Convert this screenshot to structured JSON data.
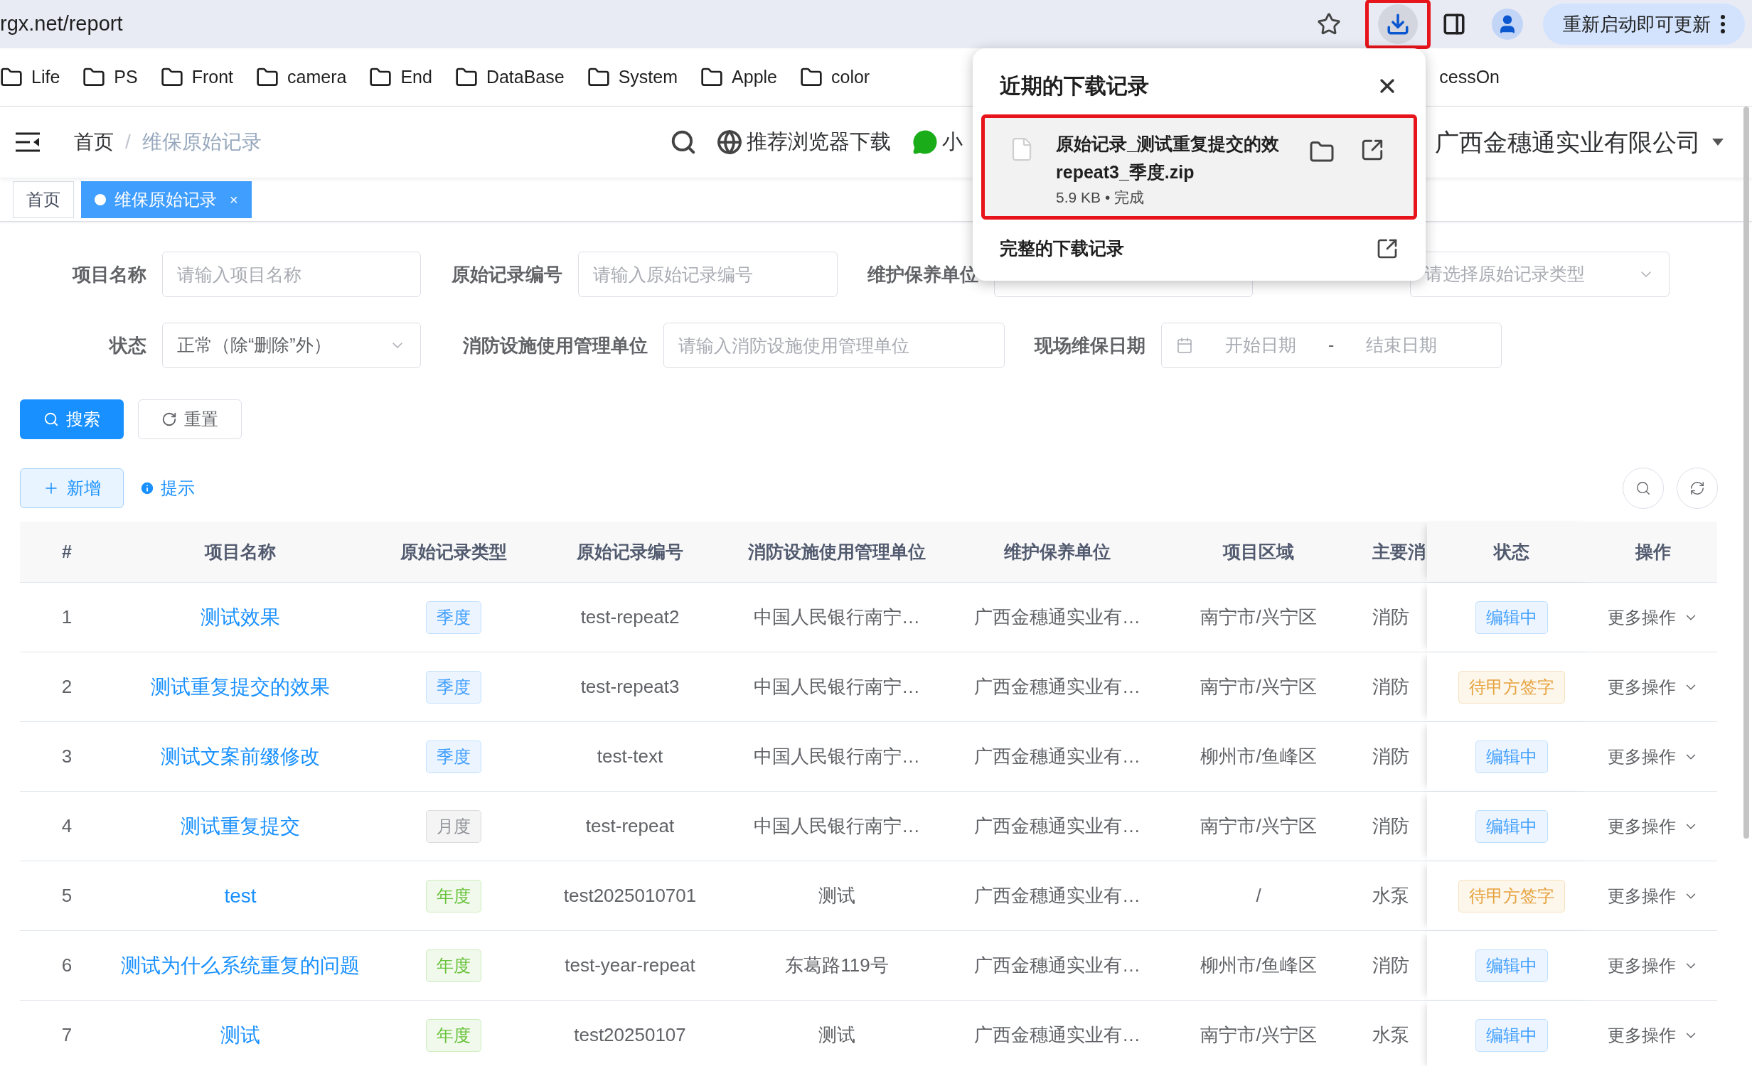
{
  "browser": {
    "url": "rgx.net/report",
    "download_highlighted": true,
    "update_button": "重新启动即可更新"
  },
  "bookmarks": [
    {
      "label": "Life",
      "kind": "folder"
    },
    {
      "label": "PS",
      "kind": "folder"
    },
    {
      "label": "Front",
      "kind": "folder"
    },
    {
      "label": "camera",
      "kind": "folder"
    },
    {
      "label": "End",
      "kind": "folder"
    },
    {
      "label": "DataBase",
      "kind": "folder"
    },
    {
      "label": "System",
      "kind": "folder"
    },
    {
      "label": "Apple",
      "kind": "folder"
    },
    {
      "label": "color",
      "kind": "folder"
    },
    {
      "label": "cessOn",
      "kind": "text"
    }
  ],
  "header": {
    "breadcrumb": [
      "首页",
      "维保原始记录"
    ],
    "separator": "/",
    "links": [
      "推荐浏览器下载",
      "小"
    ],
    "company": "广西金穗通实业有限公司"
  },
  "tabs": [
    {
      "label": "首页",
      "selected": false
    },
    {
      "label": "维保原始记录",
      "selected": true,
      "close": "×"
    }
  ],
  "filters": [
    [
      {
        "kind": "input",
        "label": "项目名称",
        "placeholder": "请输入项目名称"
      },
      {
        "kind": "input",
        "label": "原始记录编号",
        "placeholder": "请输入原始记录编号"
      },
      {
        "kind": "input",
        "label": "维护保养单位"
      },
      {
        "kind": "select",
        "placeholder": "请选择原始记录类型"
      }
    ],
    [
      {
        "kind": "select",
        "label": "状态",
        "value": "正常（除“删除”外）"
      },
      {
        "kind": "input",
        "label": "消防设施使用管理单位",
        "placeholder": "请输入消防设施使用管理单位"
      },
      {
        "kind": "daterange",
        "label": "现场维保日期",
        "start_placeholder": "开始日期",
        "separator": "-",
        "end_placeholder": "结束日期"
      }
    ]
  ],
  "actions": {
    "search": "搜索",
    "reset": "重置",
    "add": "新增",
    "hint": "提示"
  },
  "table": {
    "columns": [
      "#",
      "项目名称",
      "原始记录类型",
      "原始记录编号",
      "消防设施使用管理单位",
      "维护保养单位",
      "项目区域",
      "主要消",
      "状态",
      "操作"
    ],
    "rows": [
      {
        "index": "1",
        "name": "测试效果",
        "type": {
          "label": "季度",
          "color": "#409eff"
        },
        "code": "test-repeat2",
        "unit": "中国人民银行南宁…",
        "maintainer": "广西金穗通实业有…",
        "area": "南宁市/兴宁区",
        "main": "消防",
        "status": {
          "label": "编辑中",
          "color": "#409eff"
        },
        "action": "更多操作"
      },
      {
        "index": "2",
        "name": "测试重复提交的效果",
        "type": {
          "label": "季度",
          "color": "#409eff"
        },
        "code": "test-repeat3",
        "unit": "中国人民银行南宁…",
        "maintainer": "广西金穗通实业有…",
        "area": "南宁市/兴宁区",
        "main": "消防",
        "status": {
          "label": "待甲方签字",
          "color": "#e6a23c"
        },
        "action": "更多操作"
      },
      {
        "index": "3",
        "name": "测试文案前缀修改",
        "type": {
          "label": "季度",
          "color": "#409eff"
        },
        "code": "test-text",
        "unit": "中国人民银行南宁…",
        "maintainer": "广西金穗通实业有…",
        "area": "柳州市/鱼峰区",
        "main": "消防",
        "status": {
          "label": "编辑中",
          "color": "#409eff"
        },
        "action": "更多操作"
      },
      {
        "index": "4",
        "name": "测试重复提交",
        "type": {
          "label": "月度",
          "color": "#909399"
        },
        "code": "test-repeat",
        "unit": "中国人民银行南宁…",
        "maintainer": "广西金穗通实业有…",
        "area": "南宁市/兴宁区",
        "main": "消防",
        "status": {
          "label": "编辑中",
          "color": "#409eff"
        },
        "action": "更多操作"
      },
      {
        "index": "5",
        "name": "test",
        "type": {
          "label": "年度",
          "color": "#67c23a"
        },
        "code": "test2025010701",
        "unit": "测试",
        "maintainer": "广西金穗通实业有…",
        "area": "/",
        "main": "水泵",
        "status": {
          "label": "待甲方签字",
          "color": "#e6a23c"
        },
        "action": "更多操作"
      },
      {
        "index": "6",
        "name": "测试为什么系统重复的问题",
        "type": {
          "label": "年度",
          "color": "#67c23a"
        },
        "code": "test-year-repeat",
        "unit": "东葛路119号",
        "maintainer": "广西金穗通实业有…",
        "area": "柳州市/鱼峰区",
        "main": "消防",
        "status": {
          "label": "编辑中",
          "color": "#409eff"
        },
        "action": "更多操作"
      },
      {
        "index": "7",
        "name": "测试",
        "type": {
          "label": "年度",
          "color": "#67c23a"
        },
        "code": "test20250107",
        "unit": "测试",
        "maintainer": "广西金穗通实业有…",
        "area": "南宁市/兴宁区",
        "main": "水泵",
        "status": {
          "label": "编辑中",
          "color": "#409eff"
        },
        "action": "更多操作"
      }
    ]
  },
  "download_popup": {
    "title": "近期的下载记录",
    "file": {
      "name": "原始记录_测试重复提交的效",
      "name_line2": "repeat3_季度.zip",
      "meta": "5.9 KB • 完成",
      "highlighted": true
    },
    "all_downloads": "完整的下载记录"
  }
}
